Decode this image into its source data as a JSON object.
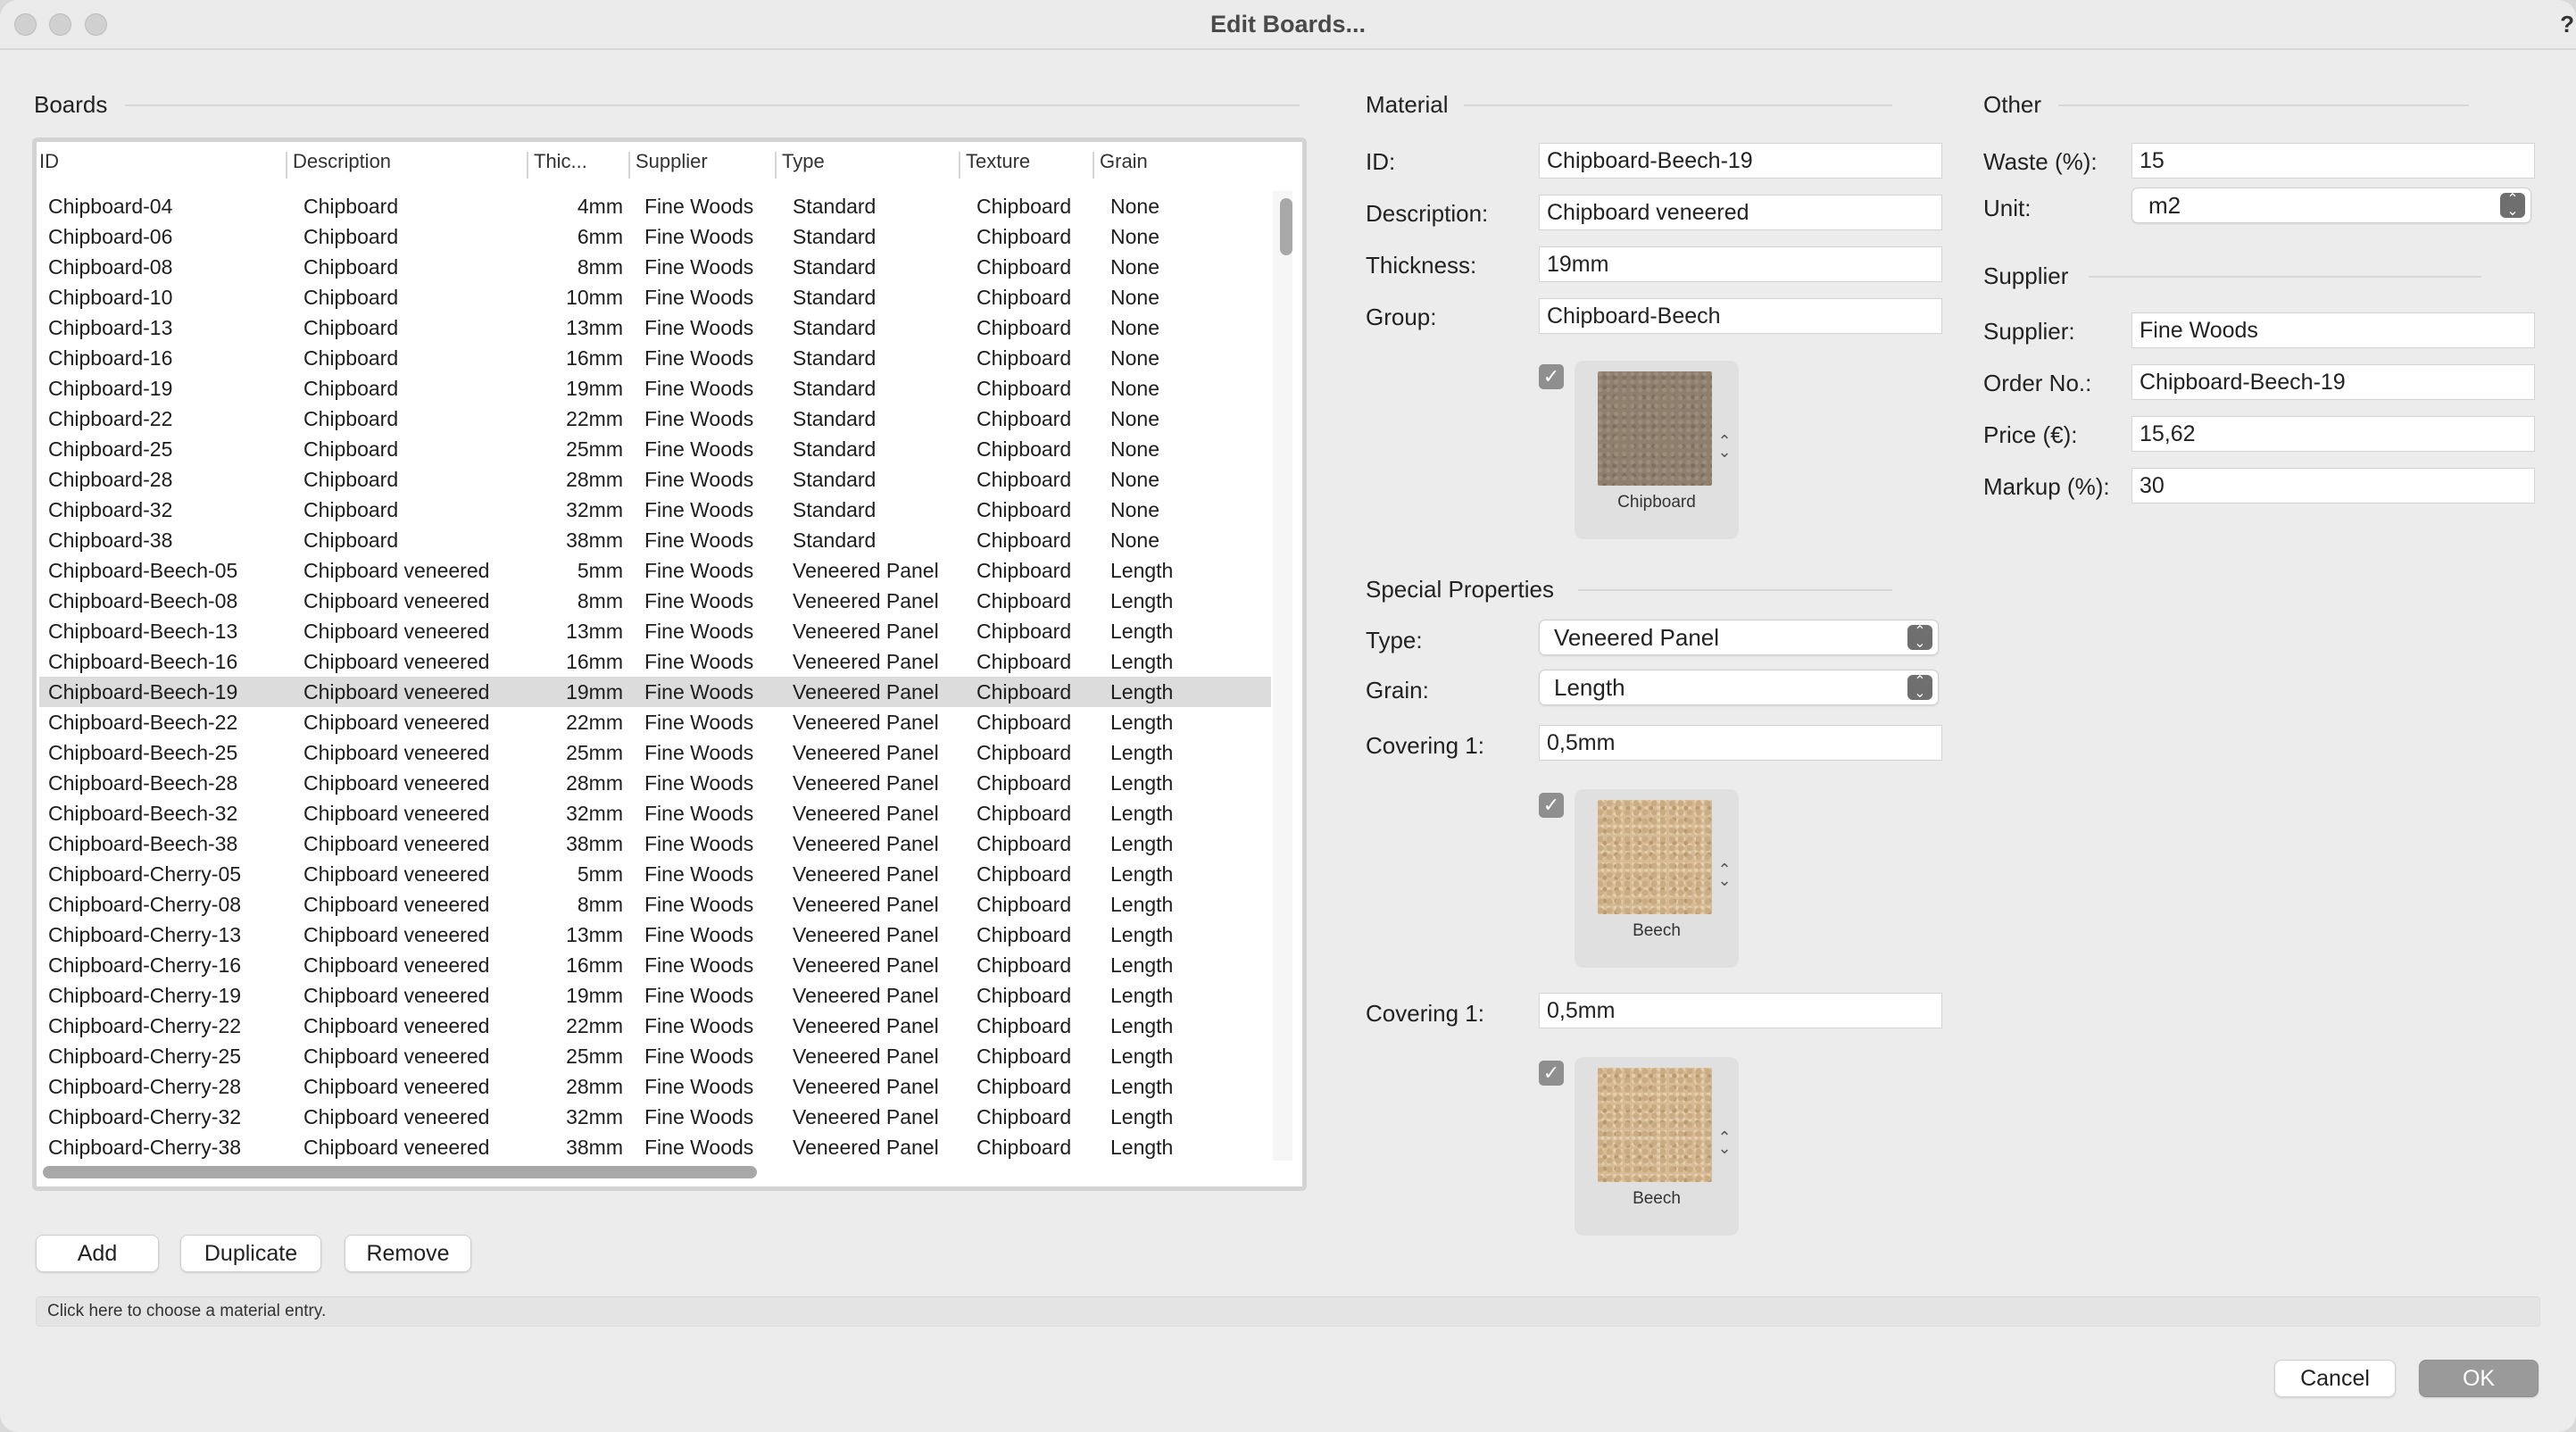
{
  "window": {
    "title": "Edit Boards...",
    "help_glyph": "?"
  },
  "boards": {
    "section_title": "Boards",
    "columns": [
      "ID",
      "Description",
      "Thic...",
      "Supplier",
      "Type",
      "Texture",
      "Grain"
    ],
    "rows": [
      {
        "id": "Chipboard-04",
        "description": "Chipboard",
        "thickness": "4mm",
        "supplier": "Fine Woods",
        "type": "Standard",
        "texture": "Chipboard",
        "grain": "None"
      },
      {
        "id": "Chipboard-06",
        "description": "Chipboard",
        "thickness": "6mm",
        "supplier": "Fine Woods",
        "type": "Standard",
        "texture": "Chipboard",
        "grain": "None"
      },
      {
        "id": "Chipboard-08",
        "description": "Chipboard",
        "thickness": "8mm",
        "supplier": "Fine Woods",
        "type": "Standard",
        "texture": "Chipboard",
        "grain": "None"
      },
      {
        "id": "Chipboard-10",
        "description": "Chipboard",
        "thickness": "10mm",
        "supplier": "Fine Woods",
        "type": "Standard",
        "texture": "Chipboard",
        "grain": "None"
      },
      {
        "id": "Chipboard-13",
        "description": "Chipboard",
        "thickness": "13mm",
        "supplier": "Fine Woods",
        "type": "Standard",
        "texture": "Chipboard",
        "grain": "None"
      },
      {
        "id": "Chipboard-16",
        "description": "Chipboard",
        "thickness": "16mm",
        "supplier": "Fine Woods",
        "type": "Standard",
        "texture": "Chipboard",
        "grain": "None"
      },
      {
        "id": "Chipboard-19",
        "description": "Chipboard",
        "thickness": "19mm",
        "supplier": "Fine Woods",
        "type": "Standard",
        "texture": "Chipboard",
        "grain": "None"
      },
      {
        "id": "Chipboard-22",
        "description": "Chipboard",
        "thickness": "22mm",
        "supplier": "Fine Woods",
        "type": "Standard",
        "texture": "Chipboard",
        "grain": "None"
      },
      {
        "id": "Chipboard-25",
        "description": "Chipboard",
        "thickness": "25mm",
        "supplier": "Fine Woods",
        "type": "Standard",
        "texture": "Chipboard",
        "grain": "None"
      },
      {
        "id": "Chipboard-28",
        "description": "Chipboard",
        "thickness": "28mm",
        "supplier": "Fine Woods",
        "type": "Standard",
        "texture": "Chipboard",
        "grain": "None"
      },
      {
        "id": "Chipboard-32",
        "description": "Chipboard",
        "thickness": "32mm",
        "supplier": "Fine Woods",
        "type": "Standard",
        "texture": "Chipboard",
        "grain": "None"
      },
      {
        "id": "Chipboard-38",
        "description": "Chipboard",
        "thickness": "38mm",
        "supplier": "Fine Woods",
        "type": "Standard",
        "texture": "Chipboard",
        "grain": "None"
      },
      {
        "id": "Chipboard-Beech-05",
        "description": "Chipboard veneered",
        "thickness": "5mm",
        "supplier": "Fine Woods",
        "type": "Veneered Panel",
        "texture": "Chipboard",
        "grain": "Length"
      },
      {
        "id": "Chipboard-Beech-08",
        "description": "Chipboard veneered",
        "thickness": "8mm",
        "supplier": "Fine Woods",
        "type": "Veneered Panel",
        "texture": "Chipboard",
        "grain": "Length"
      },
      {
        "id": "Chipboard-Beech-13",
        "description": "Chipboard veneered",
        "thickness": "13mm",
        "supplier": "Fine Woods",
        "type": "Veneered Panel",
        "texture": "Chipboard",
        "grain": "Length"
      },
      {
        "id": "Chipboard-Beech-16",
        "description": "Chipboard veneered",
        "thickness": "16mm",
        "supplier": "Fine Woods",
        "type": "Veneered Panel",
        "texture": "Chipboard",
        "grain": "Length"
      },
      {
        "id": "Chipboard-Beech-19",
        "description": "Chipboard veneered",
        "thickness": "19mm",
        "supplier": "Fine Woods",
        "type": "Veneered Panel",
        "texture": "Chipboard",
        "grain": "Length",
        "selected": true
      },
      {
        "id": "Chipboard-Beech-22",
        "description": "Chipboard veneered",
        "thickness": "22mm",
        "supplier": "Fine Woods",
        "type": "Veneered Panel",
        "texture": "Chipboard",
        "grain": "Length"
      },
      {
        "id": "Chipboard-Beech-25",
        "description": "Chipboard veneered",
        "thickness": "25mm",
        "supplier": "Fine Woods",
        "type": "Veneered Panel",
        "texture": "Chipboard",
        "grain": "Length"
      },
      {
        "id": "Chipboard-Beech-28",
        "description": "Chipboard veneered",
        "thickness": "28mm",
        "supplier": "Fine Woods",
        "type": "Veneered Panel",
        "texture": "Chipboard",
        "grain": "Length"
      },
      {
        "id": "Chipboard-Beech-32",
        "description": "Chipboard veneered",
        "thickness": "32mm",
        "supplier": "Fine Woods",
        "type": "Veneered Panel",
        "texture": "Chipboard",
        "grain": "Length"
      },
      {
        "id": "Chipboard-Beech-38",
        "description": "Chipboard veneered",
        "thickness": "38mm",
        "supplier": "Fine Woods",
        "type": "Veneered Panel",
        "texture": "Chipboard",
        "grain": "Length"
      },
      {
        "id": "Chipboard-Cherry-05",
        "description": "Chipboard veneered",
        "thickness": "5mm",
        "supplier": "Fine Woods",
        "type": "Veneered Panel",
        "texture": "Chipboard",
        "grain": "Length"
      },
      {
        "id": "Chipboard-Cherry-08",
        "description": "Chipboard veneered",
        "thickness": "8mm",
        "supplier": "Fine Woods",
        "type": "Veneered Panel",
        "texture": "Chipboard",
        "grain": "Length"
      },
      {
        "id": "Chipboard-Cherry-13",
        "description": "Chipboard veneered",
        "thickness": "13mm",
        "supplier": "Fine Woods",
        "type": "Veneered Panel",
        "texture": "Chipboard",
        "grain": "Length"
      },
      {
        "id": "Chipboard-Cherry-16",
        "description": "Chipboard veneered",
        "thickness": "16mm",
        "supplier": "Fine Woods",
        "type": "Veneered Panel",
        "texture": "Chipboard",
        "grain": "Length"
      },
      {
        "id": "Chipboard-Cherry-19",
        "description": "Chipboard veneered",
        "thickness": "19mm",
        "supplier": "Fine Woods",
        "type": "Veneered Panel",
        "texture": "Chipboard",
        "grain": "Length"
      },
      {
        "id": "Chipboard-Cherry-22",
        "description": "Chipboard veneered",
        "thickness": "22mm",
        "supplier": "Fine Woods",
        "type": "Veneered Panel",
        "texture": "Chipboard",
        "grain": "Length"
      },
      {
        "id": "Chipboard-Cherry-25",
        "description": "Chipboard veneered",
        "thickness": "25mm",
        "supplier": "Fine Woods",
        "type": "Veneered Panel",
        "texture": "Chipboard",
        "grain": "Length"
      },
      {
        "id": "Chipboard-Cherry-28",
        "description": "Chipboard veneered",
        "thickness": "28mm",
        "supplier": "Fine Woods",
        "type": "Veneered Panel",
        "texture": "Chipboard",
        "grain": "Length"
      },
      {
        "id": "Chipboard-Cherry-32",
        "description": "Chipboard veneered",
        "thickness": "32mm",
        "supplier": "Fine Woods",
        "type": "Veneered Panel",
        "texture": "Chipboard",
        "grain": "Length"
      },
      {
        "id": "Chipboard-Cherry-38",
        "description": "Chipboard veneered",
        "thickness": "38mm",
        "supplier": "Fine Woods",
        "type": "Veneered Panel",
        "texture": "Chipboard",
        "grain": "Length"
      }
    ],
    "buttons": {
      "add": "Add",
      "duplicate": "Duplicate",
      "remove": "Remove"
    }
  },
  "status_text": "Click here to choose a material entry.",
  "material": {
    "section_title": "Material",
    "id_label": "ID:",
    "id_value": "Chipboard-Beech-19",
    "description_label": "Description:",
    "description_value": "Chipboard veneered",
    "thickness_label": "Thickness:",
    "thickness_value": "19mm",
    "group_label": "Group:",
    "group_value": "Chipboard-Beech",
    "texture_checked": true,
    "texture_label": "Chipboard"
  },
  "special": {
    "section_title": "Special Properties",
    "type_label": "Type:",
    "type_value": "Veneered Panel",
    "grain_label": "Grain:",
    "grain_value": "Length",
    "covering1_label": "Covering 1:",
    "covering1_value": "0,5mm",
    "covering1_texture": "Beech",
    "covering2_label": "Covering 1:",
    "covering2_value": "0,5mm",
    "covering2_texture": "Beech"
  },
  "other": {
    "section_title": "Other",
    "waste_label": "Waste (%):",
    "waste_value": "15",
    "unit_label": "Unit:",
    "unit_value": "m2"
  },
  "supplier": {
    "section_title": "Supplier",
    "supplier_label": "Supplier:",
    "supplier_value": "Fine Woods",
    "order_label": "Order No.:",
    "order_value": "Chipboard-Beech-19",
    "price_label": "Price (€):",
    "price_value": "15,62",
    "markup_label": "Markup (%):",
    "markup_value": "30"
  },
  "footer": {
    "cancel": "Cancel",
    "ok": "OK"
  }
}
